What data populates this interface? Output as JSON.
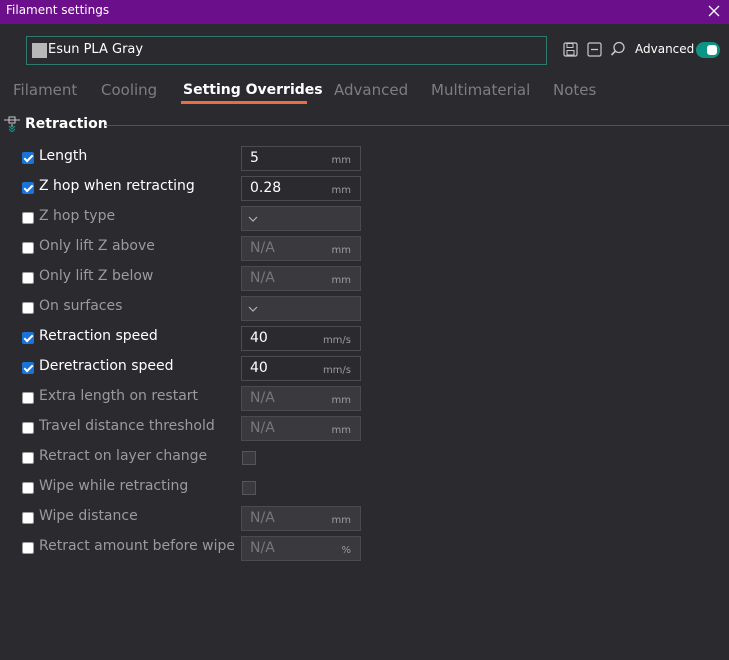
{
  "window": {
    "title": "Filament settings"
  },
  "preset": {
    "name": "Esun PLA Gray",
    "swatch_color": "#b8b8b8"
  },
  "toolbar": {
    "advanced_label": "Advanced",
    "advanced_on": true
  },
  "tabs": [
    {
      "label": "Filament",
      "active": false
    },
    {
      "label": "Cooling",
      "active": false
    },
    {
      "label": "Setting Overrides",
      "active": true
    },
    {
      "label": "Advanced",
      "active": false
    },
    {
      "label": "Multimaterial",
      "active": false
    },
    {
      "label": "Notes",
      "active": false
    }
  ],
  "section": {
    "title": "Retraction"
  },
  "rows": [
    {
      "label": "Length",
      "checked": true,
      "type": "input",
      "value": "5",
      "unit": "mm"
    },
    {
      "label": "Z hop when retracting",
      "checked": true,
      "type": "input",
      "value": "0.28",
      "unit": "mm"
    },
    {
      "label": "Z hop type",
      "checked": false,
      "type": "dropdown"
    },
    {
      "label": "Only lift Z above",
      "checked": false,
      "type": "input",
      "value": "N/A",
      "unit": "mm"
    },
    {
      "label": "Only lift Z below",
      "checked": false,
      "type": "input",
      "value": "N/A",
      "unit": "mm"
    },
    {
      "label": "On surfaces",
      "checked": false,
      "type": "dropdown"
    },
    {
      "label": "Retraction speed",
      "checked": true,
      "type": "input",
      "value": "40",
      "unit": "mm/s"
    },
    {
      "label": "Deretraction speed",
      "checked": true,
      "type": "input",
      "value": "40",
      "unit": "mm/s"
    },
    {
      "label": "Extra length on restart",
      "checked": false,
      "type": "input",
      "value": "N/A",
      "unit": "mm"
    },
    {
      "label": "Travel distance threshold",
      "checked": false,
      "type": "input",
      "value": "N/A",
      "unit": "mm"
    },
    {
      "label": "Retract on layer change",
      "checked": false,
      "type": "checkbox"
    },
    {
      "label": "Wipe while retracting",
      "checked": false,
      "type": "checkbox"
    },
    {
      "label": "Wipe distance",
      "checked": false,
      "type": "input",
      "value": "N/A",
      "unit": "mm"
    },
    {
      "label": "Retract amount before wipe",
      "checked": false,
      "type": "input",
      "value": "N/A",
      "unit": "%"
    }
  ],
  "colors": {
    "titlebar": "#6c0f8a",
    "accent": "#e86d45",
    "toggle": "#0e9485",
    "checkbox": "#1a73d9"
  }
}
